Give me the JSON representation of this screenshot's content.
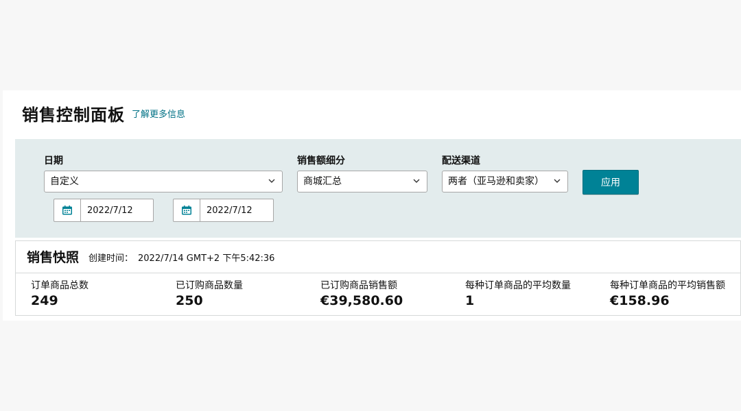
{
  "header": {
    "title": "销售控制面板",
    "learn_more": "了解更多信息"
  },
  "filters": {
    "date_label": "日期",
    "date_select": "自定义",
    "start_date": "2022/7/12",
    "end_date": "2022/7/12",
    "breakdown_label": "销售额细分",
    "breakdown_select": "商城汇总",
    "channel_label": "配送渠道",
    "channel_select": "两者（亚马逊和卖家）",
    "apply_label": "应用"
  },
  "snapshot": {
    "title": "销售快照",
    "created_label": "创建时间：",
    "created_time": "2022/7/14 GMT+2 下午5:42:36",
    "metrics": [
      {
        "label": "订单商品总数",
        "value": "249"
      },
      {
        "label": "已订购商品数量",
        "value": "250"
      },
      {
        "label": "已订购商品销售额",
        "value": "€39,580.60"
      },
      {
        "label": "每种订单商品的平均数量",
        "value": "1"
      },
      {
        "label": "每种订单商品的平均销售额",
        "value": "€158.96"
      }
    ]
  },
  "icons": {
    "calendar": "calendar-icon",
    "dropdown": "chevron-down-icon"
  },
  "colors": {
    "accent": "#008296",
    "link": "#007185",
    "filter_bg": "#e3eced"
  }
}
